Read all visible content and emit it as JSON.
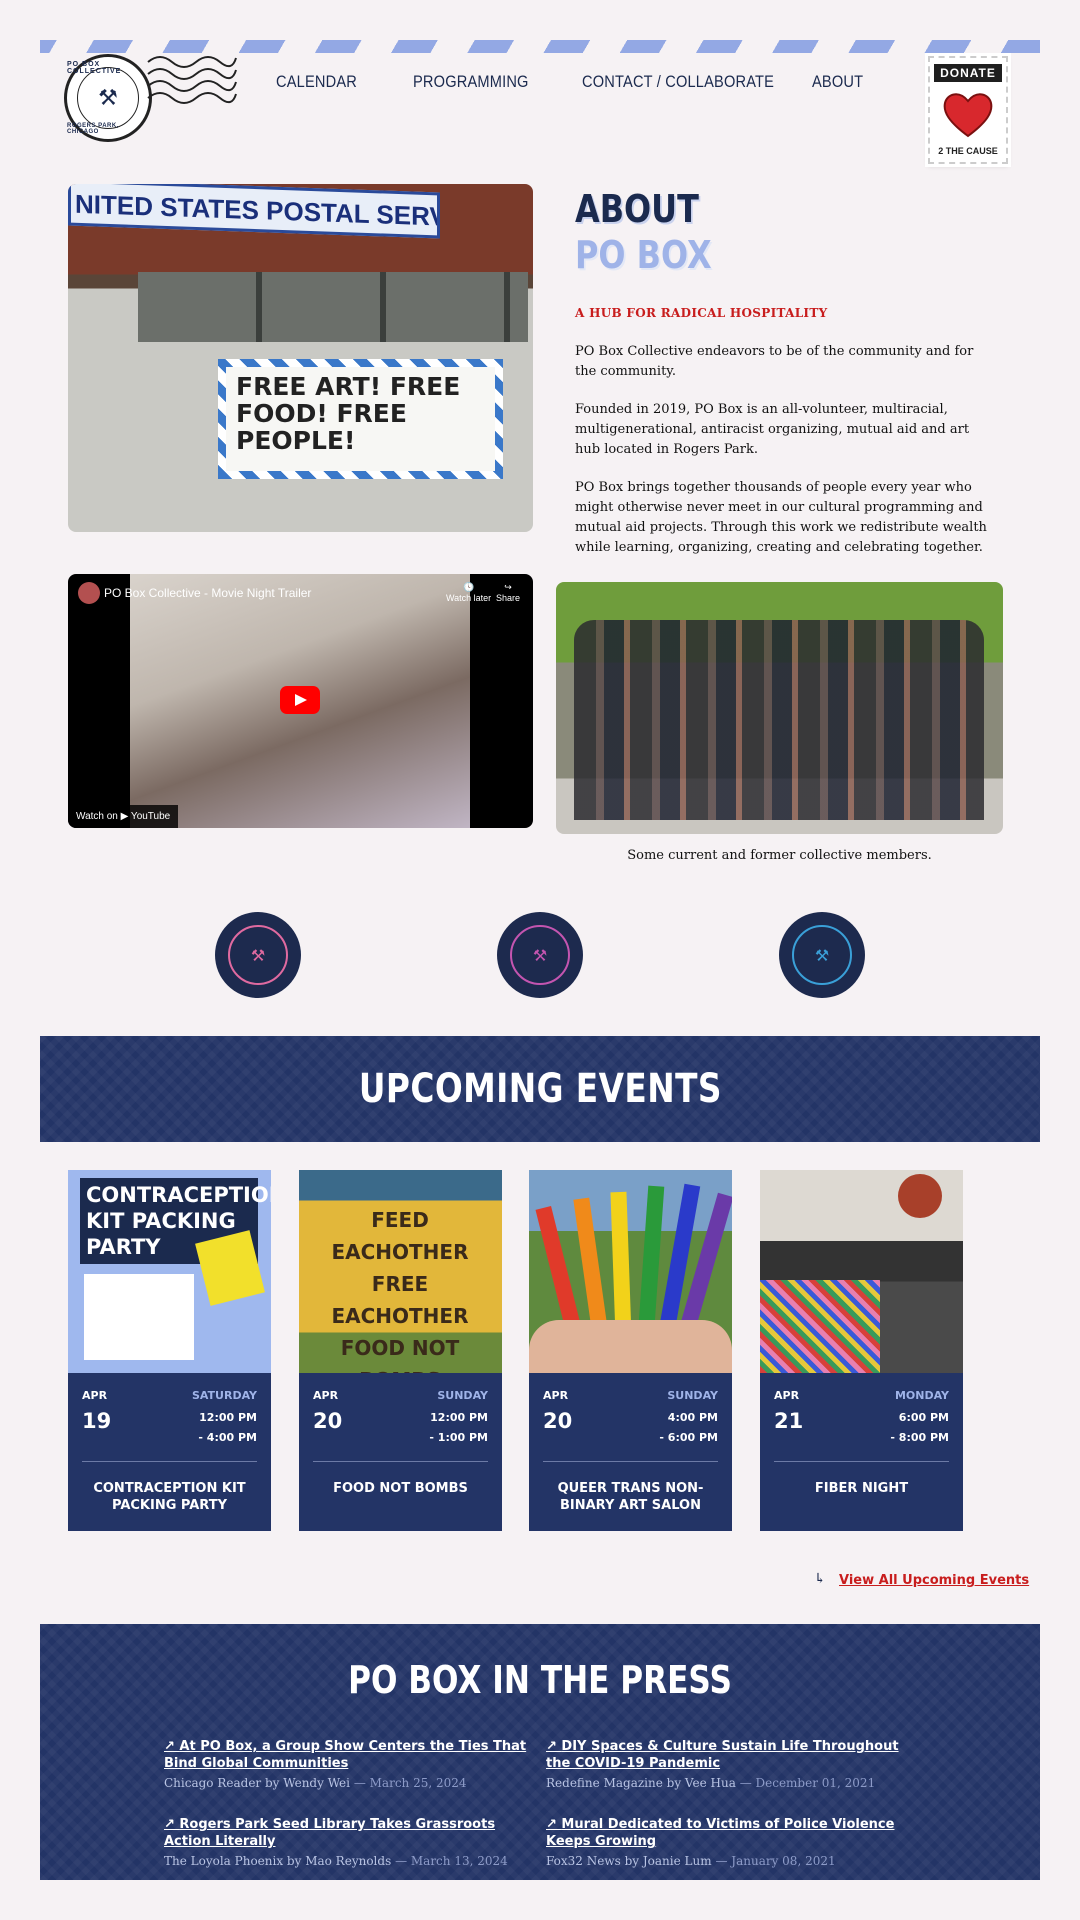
{
  "header": {
    "logo": {
      "ring_top": "PO BOX COLLECTIVE",
      "ring_bottom": "ROGERS PARK, CHICAGO"
    },
    "nav": [
      "CALENDAR",
      "PROGRAMMING",
      "CONTACT / COLLABORATE",
      "ABOUT"
    ],
    "donate": {
      "label": "DONATE",
      "sub": "2 THE CAUSE"
    }
  },
  "hero_image": {
    "banner": "NITED STATES POSTAL SERVICE",
    "sign": "FREE ART! FREE FOOD! FREE PEOPLE!"
  },
  "about": {
    "title_line1": "ABOUT",
    "title_line2": "PO BOX",
    "tagline": "A HUB FOR RADICAL HOSPITALITY",
    "paragraphs": [
      "PO Box Collective endeavors to be of the community and for the community.",
      "Founded in 2019, PO Box is an all-volunteer, multiracial, multigenerational, antiracist organizing, mutual aid and art hub located in Rogers Park.",
      "PO Box brings together thousands of people every year who might otherwise never meet in our cultural programming and mutual aid projects. Through this work we redistribute wealth while learning, organizing, creating and celebrating together."
    ]
  },
  "video": {
    "title": "PO Box Collective - Movie Night Trailer",
    "watch_later": "Watch later",
    "share": "Share",
    "watch_on": "Watch on ▶ YouTube"
  },
  "group_caption": "Some current and former collective members.",
  "events": {
    "heading": "UPCOMING EVENTS",
    "items": [
      {
        "month": "APR",
        "day": "19",
        "weekday": "SATURDAY",
        "start": "12:00 PM",
        "end": "- 4:00 PM",
        "name": "CONTRACEPTION KIT PACKING PARTY",
        "poster": "CONTRACEPTION KIT PACKING PARTY"
      },
      {
        "month": "APR",
        "day": "20",
        "weekday": "SUNDAY",
        "start": "12:00 PM",
        "end": "- 1:00 PM",
        "name": "FOOD NOT BOMBS",
        "poster": "FEED EACHOTHER FREE EACHOTHER FOOD NOT BOMBS"
      },
      {
        "month": "APR",
        "day": "20",
        "weekday": "SUNDAY",
        "start": "4:00 PM",
        "end": "- 6:00 PM",
        "name": "QUEER TRANS NON-BINARY ART SALON"
      },
      {
        "month": "APR",
        "day": "21",
        "weekday": "MONDAY",
        "start": "6:00 PM",
        "end": "- 8:00 PM",
        "name": "FIBER NIGHT"
      }
    ],
    "view_all": "View All Upcoming Events"
  },
  "press": {
    "heading": "PO BOX IN THE PRESS",
    "items": [
      {
        "headline": "At PO Box, a Group Show Centers the Ties That Bind Global Communities",
        "source": "Chicago Reader by Wendy Wei",
        "date": "— March 25, 2024"
      },
      {
        "headline": "DIY Spaces & Culture Sustain Life Throughout the COVID-19 Pandemic",
        "source": "Redefine Magazine by Vee Hua",
        "date": "— December 01, 2021"
      },
      {
        "headline": "Rogers Park Seed Library Takes Grassroots Action Literally",
        "source": "The Loyola Phoenix by Mao Reynolds",
        "date": "— March 13, 2024"
      },
      {
        "headline": "Mural Dedicated to Victims of Police Violence Keeps Growing",
        "source": "Fox32 News by Joanie Lum",
        "date": "— January 08, 2021"
      }
    ]
  },
  "colors": {
    "navy": "#233466",
    "periwinkle": "#9fb3e8",
    "red": "#c81d1d",
    "background": "#f6f2f4"
  }
}
